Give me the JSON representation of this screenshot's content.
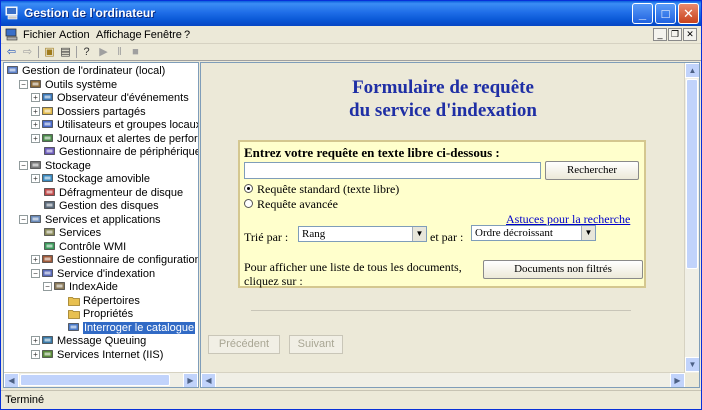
{
  "window": {
    "title": "Gestion de l'ordinateur",
    "caption_minimize": "_",
    "caption_maximize": "□",
    "caption_close": "✕"
  },
  "menubar": {
    "items": [
      "Fichier",
      "Action",
      "Affichage",
      "Fenêtre",
      "?"
    ],
    "mdi_minimize": "_",
    "mdi_restore": "❐",
    "mdi_close": "✕"
  },
  "toolbar": {
    "back": "⇦",
    "forward": "⇨",
    "up_folder": "▣",
    "show_tree": "▤",
    "help": "?",
    "play": "▶",
    "pause": "‖",
    "stop": "■"
  },
  "tree": {
    "items": [
      {
        "label": "Gestion de l'ordinateur (local)",
        "icon": "computer-icon",
        "expander": "",
        "level": 0
      },
      {
        "label": "Outils système",
        "icon": "tools-icon",
        "expander": "−",
        "level": 1
      },
      {
        "label": "Observateur d'événements",
        "icon": "event-viewer-icon",
        "expander": "+",
        "level": 2
      },
      {
        "label": "Dossiers partagés",
        "icon": "shared-folder-icon",
        "expander": "+",
        "level": 2
      },
      {
        "label": "Utilisateurs et groupes locaux",
        "icon": "users-icon",
        "expander": "+",
        "level": 2
      },
      {
        "label": "Journaux et alertes de performance",
        "icon": "performance-icon",
        "expander": "+",
        "level": 2
      },
      {
        "label": "Gestionnaire de périphériques",
        "icon": "device-manager-icon",
        "expander": "",
        "level": 2
      },
      {
        "label": "Stockage",
        "icon": "storage-icon",
        "expander": "−",
        "level": 1
      },
      {
        "label": "Stockage amovible",
        "icon": "removable-storage-icon",
        "expander": "+",
        "level": 2
      },
      {
        "label": "Défragmenteur de disque",
        "icon": "defrag-icon",
        "expander": "",
        "level": 2
      },
      {
        "label": "Gestion des disques",
        "icon": "disk-management-icon",
        "expander": "",
        "level": 2
      },
      {
        "label": "Services et applications",
        "icon": "services-apps-icon",
        "expander": "−",
        "level": 1
      },
      {
        "label": "Services",
        "icon": "services-icon",
        "expander": "",
        "level": 2
      },
      {
        "label": "Contrôle WMI",
        "icon": "wmi-icon",
        "expander": "",
        "level": 2
      },
      {
        "label": "Gestionnaire de configuration SQL Se",
        "icon": "sql-config-icon",
        "expander": "+",
        "level": 2
      },
      {
        "label": "Service d'indexation",
        "icon": "indexing-service-icon",
        "expander": "−",
        "level": 2
      },
      {
        "label": "IndexAide",
        "icon": "catalog-icon",
        "expander": "−",
        "level": 3
      },
      {
        "label": "Répertoires",
        "icon": "folder-icon",
        "expander": "",
        "level": 4
      },
      {
        "label": "Propriétés",
        "icon": "folder-icon",
        "expander": "",
        "level": 4
      },
      {
        "label": "Interroger le catalogue",
        "icon": "query-icon",
        "expander": "",
        "level": 4,
        "selected": true
      },
      {
        "label": "Message Queuing",
        "icon": "message-queuing-icon",
        "expander": "+",
        "level": 2
      },
      {
        "label": "Services Internet (IIS)",
        "icon": "iis-icon",
        "expander": "+",
        "level": 2
      }
    ]
  },
  "content": {
    "title_line1": "Formulaire de requête",
    "title_line2": "du service d'indexation",
    "form": {
      "prompt": "Entrez votre requête en texte libre ci-dessous :",
      "query_value": "",
      "search_button": "Rechercher",
      "radio_standard": "Requête standard (texte libre)",
      "radio_advanced": "Requête avancée",
      "tips_link": "Astuces pour la recherche",
      "sort_by_label": "Trié par :",
      "sort_by_value": "Rang",
      "then_by_label": "et par :",
      "then_by_value": "Ordre décroissant",
      "list_all_line1": "Pour afficher une liste de tous les documents,",
      "list_all_line2": "cliquez sur :",
      "unfiltered_button": "Documents non filtrés"
    },
    "prev_button": "Précédent",
    "next_button": "Suivant"
  },
  "statusbar": {
    "text": "Terminé"
  },
  "colors": {
    "title_blue": "#1f2fa5",
    "selection": "#316ac5",
    "form_background": "#ffffcc"
  }
}
